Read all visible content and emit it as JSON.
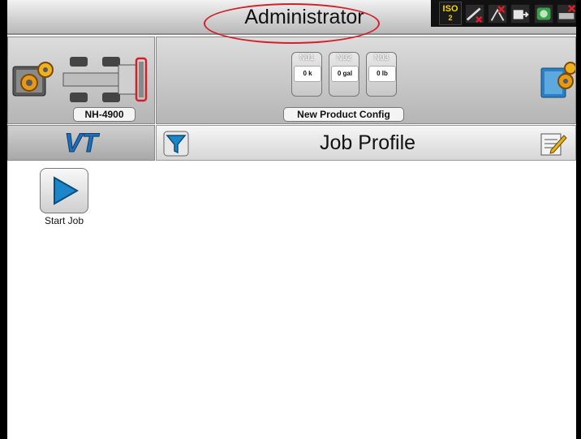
{
  "header": {
    "title": "Administrator",
    "status_icons": {
      "iso": {
        "label": "ISO",
        "sub": "2"
      },
      "items": [
        "iso-icon",
        "gps-warning-icon",
        "antenna-warning-icon",
        "logging-icon",
        "implement-status-icon",
        "section-warning-icon"
      ]
    }
  },
  "equipment": {
    "name": "NH-4900",
    "icons": [
      "equipment-config-icon",
      "vehicle-icon"
    ]
  },
  "product": {
    "name": "New Product Config",
    "tanks": [
      {
        "name": "N01",
        "value": "0 k"
      },
      {
        "name": "N02",
        "value": "0 gal"
      },
      {
        "name": "N03",
        "value": "0 lb"
      }
    ]
  },
  "tabs": {
    "vt_label": "VT"
  },
  "job_profile": {
    "title": "Job Profile"
  },
  "actions": {
    "start_job_label": "Start Job"
  },
  "colors": {
    "highlight_ring": "#d2202a",
    "vt_blue": "#1f6fb8",
    "start_blue": "#1c86c9"
  }
}
